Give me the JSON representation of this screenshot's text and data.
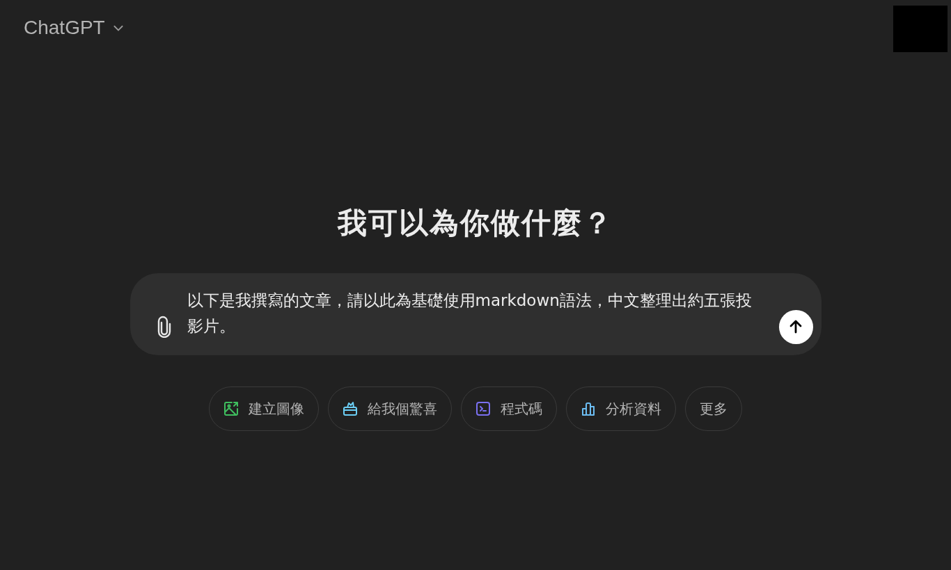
{
  "header": {
    "model": "ChatGPT"
  },
  "heading": "我可以為你做什麼？",
  "composer": {
    "value": "以下是我撰寫的文章，請以此為基礎使用markdown語法，中文整理出約五張投影片。"
  },
  "suggestions": [
    {
      "kind": "image",
      "color": "#3fbf5f",
      "label": "建立圖像"
    },
    {
      "kind": "gift",
      "color": "#6ccff6",
      "label": "給我個驚喜"
    },
    {
      "kind": "code",
      "color": "#7a70f0",
      "label": "程式碼"
    },
    {
      "kind": "chart",
      "color": "#6cbdf2",
      "label": "分析資料"
    },
    {
      "kind": "more",
      "label": "更多"
    }
  ]
}
